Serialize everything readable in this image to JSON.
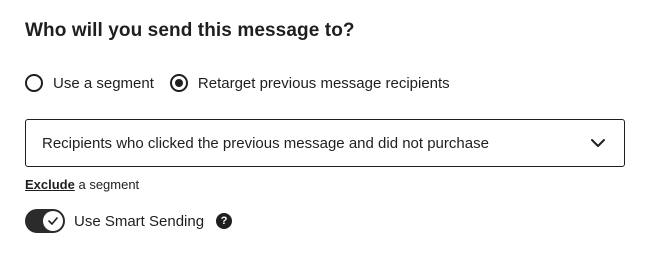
{
  "heading": "Who will you send this message to?",
  "audience_options": [
    {
      "label": "Use a segment",
      "selected": false
    },
    {
      "label": "Retarget previous message recipients",
      "selected": true
    }
  ],
  "recipients_select": {
    "value": "Recipients who clicked the previous message and did not purchase",
    "icon": "chevron-down-icon"
  },
  "exclude": {
    "link_label": "Exclude",
    "suffix": " a segment"
  },
  "smart_sending": {
    "label": "Use Smart Sending",
    "enabled": true,
    "help_icon": "question-circle-icon",
    "help_glyph": "?"
  },
  "colors": {
    "text": "#1f1f1f",
    "toggle_on": "#2b2b2b",
    "background": "#ffffff"
  }
}
